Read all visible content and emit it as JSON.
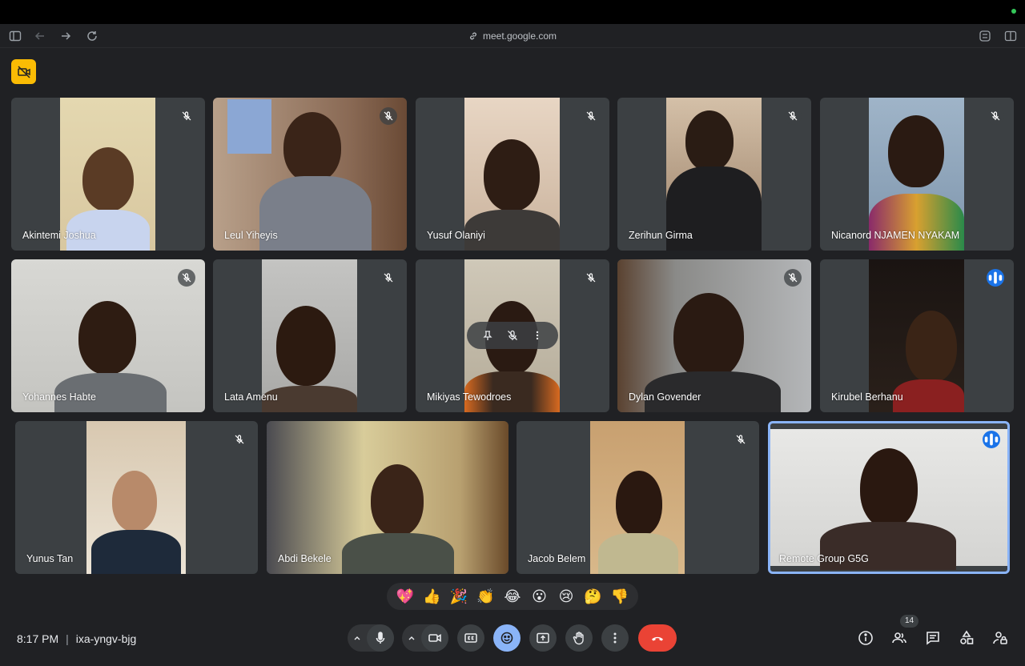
{
  "browser": {
    "url": "meet.google.com"
  },
  "participants": [
    {
      "name": "Akintemi Joshua",
      "muted": true
    },
    {
      "name": "Leul Yiheyis",
      "muted": true
    },
    {
      "name": "Yusuf Olaniyi",
      "muted": true
    },
    {
      "name": "Zerihun Girma",
      "muted": true
    },
    {
      "name": "Nicanord NJAMEN NYAKAM",
      "muted": true
    },
    {
      "name": "Yohannes Habte",
      "muted": true
    },
    {
      "name": "Lata Amenu",
      "muted": true
    },
    {
      "name": "Mikiyas Tewodroes",
      "muted": true
    },
    {
      "name": "Dylan Govender",
      "muted": true
    },
    {
      "name": "Kirubel Berhanu",
      "muted": false,
      "speaking": true
    },
    {
      "name": "Yunus Tan",
      "muted": true
    },
    {
      "name": "Abdi Bekele",
      "muted": false
    },
    {
      "name": "Jacob Belem",
      "muted": true
    },
    {
      "name": "Remote Group G5G",
      "muted": false,
      "speaking": true,
      "active": true
    }
  ],
  "reactions": [
    "💖",
    "👍",
    "🎉",
    "👏",
    "😂",
    "😮",
    "😢",
    "🤔",
    "👎"
  ],
  "meeting": {
    "time": "8:17 PM",
    "separator": "|",
    "code": "ixa-yngv-bjg"
  },
  "people_count": "14",
  "colors": {
    "background": "#202124",
    "tile": "#3c4043",
    "accent": "#8ab4f8",
    "leave": "#ea4335",
    "warning": "#fbbc04",
    "speaking": "#1a73e8"
  }
}
